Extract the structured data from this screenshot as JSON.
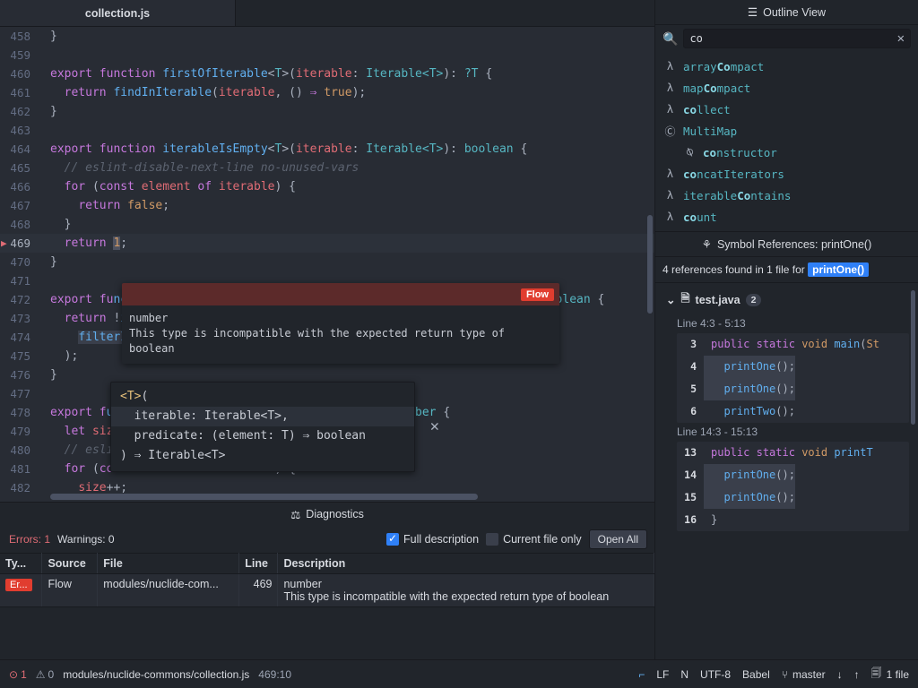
{
  "window": {
    "title": "collection.js"
  },
  "tabbar": {
    "active_tab": "collection.js"
  },
  "editor": {
    "lines": [
      {
        "num": "458",
        "html": "<span class=\"pun\">}</span>"
      },
      {
        "num": "459",
        "html": ""
      },
      {
        "num": "460",
        "html": "<span class=\"kw\">export</span> <span class=\"kw\">function</span> <span class=\"fn\">firstOfIterable</span><span class=\"pun\">&lt;</span><span class=\"typ\">T</span><span class=\"pun\">&gt;(</span><span class=\"par\">iterable</span><span class=\"pun\">: </span><span class=\"typ\">Iterable&lt;T&gt;</span><span class=\"pun\">): </span><span class=\"typ\">?T</span> <span class=\"pun\">{</span>"
      },
      {
        "num": "461",
        "html": "  <span class=\"kw\">return</span> <span class=\"fn\">findInIterable</span><span class=\"pun\">(</span><span class=\"par\">iterable</span><span class=\"pun\">, () </span><span class=\"op\">⇒</span> <span class=\"num\">true</span><span class=\"pun\">);</span>"
      },
      {
        "num": "462",
        "html": "<span class=\"pun\">}</span>"
      },
      {
        "num": "463",
        "html": ""
      },
      {
        "num": "464",
        "html": "<span class=\"kw\">export</span> <span class=\"kw\">function</span> <span class=\"fn\">iterableIsEmpty</span><span class=\"pun\">&lt;</span><span class=\"typ\">T</span><span class=\"pun\">&gt;(</span><span class=\"par\">iterable</span><span class=\"pun\">: </span><span class=\"typ\">Iterable&lt;T&gt;</span><span class=\"pun\">): </span><span class=\"typ\">boolean</span> <span class=\"pun\">{</span>"
      },
      {
        "num": "465",
        "html": "  <span class=\"cmt\">// eslint-disable-next-line no-unused-vars</span>"
      },
      {
        "num": "466",
        "html": "  <span class=\"kw\">for</span> <span class=\"pun\">(</span><span class=\"kw\">const</span> <span class=\"par\">element</span> <span class=\"kw\">of</span> <span class=\"par\">iterable</span><span class=\"pun\">) {</span>"
      },
      {
        "num": "467",
        "html": "    <span class=\"kw\">return</span> <span class=\"num\">false</span><span class=\"pun\">;</span>"
      },
      {
        "num": "468",
        "html": "  <span class=\"pun\">}</span>"
      },
      {
        "num": "469",
        "html": "  <span class=\"kw\">return</span> <span class=\"errtok num\">1</span><span class=\"pun\">;</span>",
        "current": true
      },
      {
        "num": "470",
        "html": "<span class=\"pun\">}</span>"
      },
      {
        "num": "471",
        "html": ""
      },
      {
        "num": "472",
        "html": "<span class=\"kw\">export</span> <span class=\"kw\">fu</span><span class=\"fn\">nction iterableContains</span><span class=\"pun\">&lt;T&gt;(iterable: Iterable&lt;T&gt;, value: T)</span><span class=\"pun\">: </span><span class=\"typ\">boolean</span> <span class=\"pun\">{</span>"
      },
      {
        "num": "473",
        "html": "  <span class=\"kw\">return</span> <span class=\"pun\">!</span><span class=\"fn\">iterableIsEmpty</span><span class=\"pun\">(</span>"
      },
      {
        "num": "474",
        "html": "    <span class=\"fn selbg\">filterIterable</span><span class=\"pun\">(</span><span class=\"par\">iterable</span><span class=\"pun\">, </span><span class=\"par\">element</span> <span class=\"op\">⇒</span> <span class=\"par\">element</span> <span class=\"typ\">≡</span> <span class=\"par\">value</span><span class=\"pun\">),</span>"
      },
      {
        "num": "475",
        "html": "  <span class=\"pun\">);</span>"
      },
      {
        "num": "476",
        "html": "<span class=\"pun\">}</span>"
      },
      {
        "num": "477",
        "html": ""
      },
      {
        "num": "478",
        "html": "<span class=\"kw\">export</span> <span class=\"kw\">f</span><span class=\"fn\">unction count&lt;T&gt;(iterable: Iterable&lt;T&gt;)</span><span class=\"pun\">: </span><span class=\"typ\">number</span> <span class=\"pun\">{</span>"
      },
      {
        "num": "479",
        "html": "  <span class=\"kw\">let</span> <span class=\"par\">size</span> <span class=\"pun\">= </span><span class=\"num\">0</span><span class=\"pun\">;</span>"
      },
      {
        "num": "480",
        "html": "  <span class=\"cmt\">// eslint-disable-next-line no-unused-vars</span>"
      },
      {
        "num": "481",
        "html": "  <span class=\"kw\">for</span> <span class=\"pun\">(</span><span class=\"kw\">const</span> <span class=\"par\">element</span> <span class=\"kw\">of</span> <span class=\"par\">iterable</span><span class=\"pun\">) {</span>"
      },
      {
        "num": "482",
        "html": "    <span class=\"par\">size</span><span class=\"pun\">++;</span>"
      }
    ]
  },
  "datatip": {
    "badge": "Flow",
    "type_line": "number",
    "message": "This type is incompatible with the expected return type of boolean"
  },
  "signature_help": {
    "lines": [
      "<T>(",
      "  iterable: Iterable<T>,",
      "  predicate: (element: T) ⇒ boolean",
      ") ⇒ Iterable<T>"
    ],
    "highlight_index": 1,
    "close_label": "✕"
  },
  "diagnostics": {
    "title": "Diagnostics",
    "title_icon": "scales-icon",
    "errors_label": "Errors: 1",
    "warnings_label": "Warnings: 0",
    "full_description_label": "Full description",
    "full_description_checked": true,
    "current_file_only_label": "Current file only",
    "current_file_only_checked": false,
    "open_all_label": "Open All",
    "columns": [
      "Ty...",
      "Source",
      "File",
      "Line",
      "Description"
    ],
    "rows": [
      {
        "type": "Er...",
        "source": "Flow",
        "file": "modules/nuclide-com...",
        "line": "469",
        "description_line1": "number",
        "description_line2": "This type is incompatible with the expected return type of boolean"
      }
    ]
  },
  "outline": {
    "title": "Outline View",
    "title_icon": "list-icon",
    "search": {
      "value": "co",
      "placeholder": "",
      "icon": "search-icon",
      "clear_icon": "close-icon"
    },
    "items": [
      {
        "icon": "λ",
        "icon_name": "lambda-icon",
        "prefix": "array",
        "match": "Co",
        "suffix": "mpact",
        "indent": false
      },
      {
        "icon": "λ",
        "icon_name": "lambda-icon",
        "prefix": "map",
        "match": "Co",
        "suffix": "mpact",
        "indent": false
      },
      {
        "icon": "λ",
        "icon_name": "lambda-icon",
        "prefix": "",
        "match": "co",
        "suffix": "llect",
        "indent": false
      },
      {
        "icon": "Ⓒ",
        "icon_name": "class-icon",
        "prefix": "MultiMap",
        "match": "",
        "suffix": "",
        "indent": false
      },
      {
        "icon": "⍉",
        "icon_name": "constructor-icon",
        "prefix": "",
        "match": "co",
        "suffix": "nstructor",
        "indent": true
      },
      {
        "icon": "λ",
        "icon_name": "lambda-icon",
        "prefix": "",
        "match": "co",
        "suffix": "ncatIterators",
        "indent": false
      },
      {
        "icon": "λ",
        "icon_name": "lambda-icon",
        "prefix": "iterable",
        "match": "Co",
        "suffix": "ntains",
        "indent": false
      },
      {
        "icon": "λ",
        "icon_name": "lambda-icon",
        "prefix": "",
        "match": "co",
        "suffix": "unt",
        "indent": false
      }
    ]
  },
  "symbol_references": {
    "title": "Symbol References: printOne()",
    "title_icon": "references-icon",
    "summary_prefix": "4 references found in 1 file for",
    "summary_chip": "printOne()",
    "file": {
      "name": "test.java",
      "count": "2",
      "expand_icon": "chevron-down-icon",
      "file_icon": "file-icon"
    },
    "groups": [
      {
        "range": "Line 4:3 - 5:13",
        "rows": [
          {
            "num": "3",
            "html": "<span class=\"kw\">public</span> <span class=\"kw\">static</span> <span class=\"num\">void</span> <span class=\"fn\">main</span><span class=\"pun\">(</span><span class=\"num\">St</span>",
            "hit": false
          },
          {
            "num": "4",
            "html": "  <span class=\"fn\">printOne</span><span class=\"pun\">();</span>",
            "hit": true
          },
          {
            "num": "5",
            "html": "  <span class=\"fn\">printOne</span><span class=\"pun\">();</span>",
            "hit": true
          },
          {
            "num": "6",
            "html": "  <span class=\"fn\">printTwo</span><span class=\"pun\">();</span>",
            "hit": false
          }
        ]
      },
      {
        "range": "Line 14:3 - 15:13",
        "rows": [
          {
            "num": "13",
            "html": "<span class=\"kw\">public</span> <span class=\"kw\">static</span> <span class=\"num\">void</span> <span class=\"fn\">printT</span>",
            "hit": false
          },
          {
            "num": "14",
            "html": "  <span class=\"fn\">printOne</span><span class=\"pun\">();</span>",
            "hit": true
          },
          {
            "num": "15",
            "html": "  <span class=\"fn\">printOne</span><span class=\"pun\">();</span>",
            "hit": true
          },
          {
            "num": "16",
            "html": "<span class=\"pun\">}</span>",
            "hit": false
          }
        ]
      }
    ]
  },
  "status_bar": {
    "error_count": "1",
    "warning_count": "0",
    "path": "modules/nuclide-commons/collection.js",
    "cursor": "469:10",
    "connection_icon": "signal-icon",
    "line_ending": "LF",
    "encoding_n": "N",
    "encoding": "UTF-8",
    "grammar": "Babel",
    "branch_icon": "git-branch-icon",
    "branch": "master",
    "down_icon": "↓",
    "up_icon": "↑",
    "files_icon": "file-changed-icon",
    "files_changed": "1 file"
  },
  "colors": {
    "bg": "#282c34",
    "panel_bg": "#21252b",
    "accent_blue": "#2f80f7",
    "error_red": "#e13d2f",
    "error_text": "#e06c75",
    "flow_header": "#5c2a2a"
  }
}
